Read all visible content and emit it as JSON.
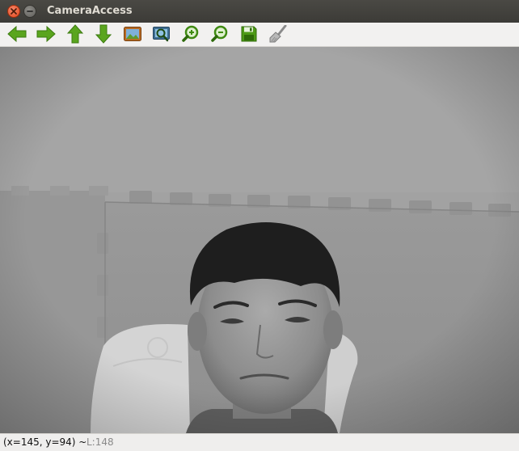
{
  "window": {
    "title": "CameraAccess"
  },
  "toolbar": {
    "buttons": [
      {
        "icon": "arrow-left-icon",
        "tooltip": ""
      },
      {
        "icon": "arrow-right-icon",
        "tooltip": ""
      },
      {
        "icon": "arrow-up-icon",
        "tooltip": ""
      },
      {
        "icon": "arrow-down-icon",
        "tooltip": ""
      },
      {
        "icon": "fit-image-icon",
        "tooltip": ""
      },
      {
        "icon": "zoom-region-icon",
        "tooltip": ""
      },
      {
        "icon": "zoom-in-icon",
        "tooltip": ""
      },
      {
        "icon": "zoom-out-icon",
        "tooltip": ""
      },
      {
        "icon": "save-icon",
        "tooltip": ""
      },
      {
        "icon": "clear-brush-icon",
        "tooltip": ""
      }
    ],
    "accent_color": "#4e9a06"
  },
  "image_view": {
    "content": "grayscale webcam frame"
  },
  "status": {
    "coords": "(x=145, y=94) ~",
    "level": "L:148"
  }
}
